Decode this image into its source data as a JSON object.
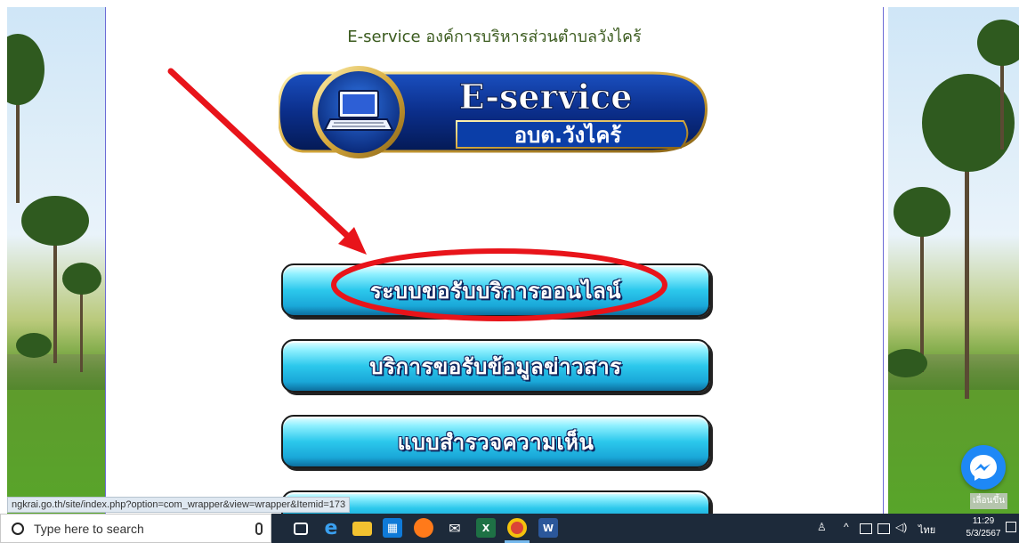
{
  "page": {
    "title": "E-service องค์การบริหารส่วนตำบลวังไคร้",
    "logo": {
      "line1": "E-service",
      "line2": "อบต.วังไคร้"
    }
  },
  "menu": [
    {
      "label": "ระบบขอรับบริการออนไลน์"
    },
    {
      "label": "บริการขอรับข้อมูลข่าวสาร"
    },
    {
      "label": "แบบสำรวจความเห็น"
    },
    {
      "label": ""
    }
  ],
  "status_url": "ngkrai.go.th/site/index.php?option=com_wrapper&view=wrapper&Itemid=173",
  "widgets": {
    "scroll_up_label": "เลื่อนขึ้น"
  },
  "taskbar": {
    "search_placeholder": "Type here to search",
    "apps": [
      "task-view",
      "edge",
      "file-explorer",
      "store",
      "firefox",
      "mail",
      "excel",
      "chrome",
      "word"
    ],
    "language": "ไทย",
    "time": "11:29",
    "date": "5/3/2567"
  },
  "colors": {
    "annotation_red": "#e8141a",
    "button_cyan": "#2cc8ec",
    "title_green": "#3b5b1e"
  }
}
